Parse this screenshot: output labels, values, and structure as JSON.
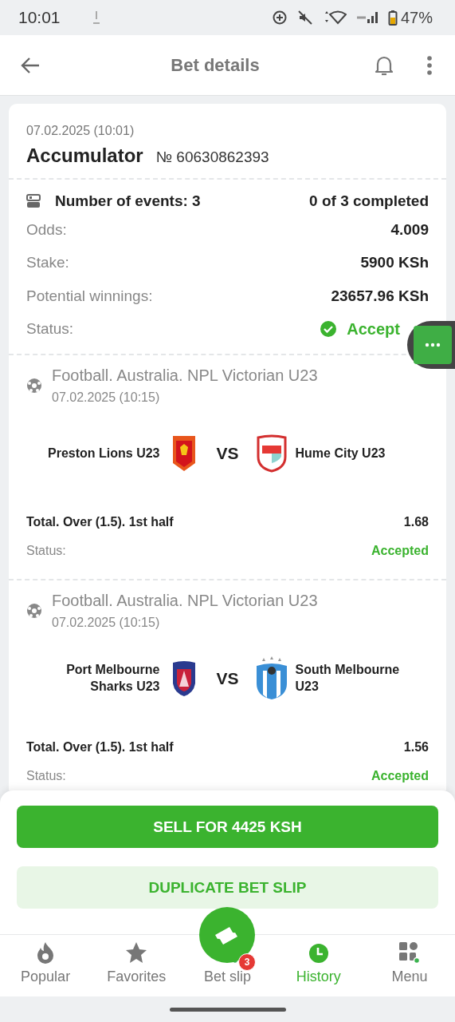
{
  "status_bar": {
    "time": "10:01",
    "battery": "47%"
  },
  "header": {
    "title": "Bet details"
  },
  "bet": {
    "date": "07.02.2025 (10:01)",
    "type": "Accumulator",
    "number": "№ 60630862393"
  },
  "summary": {
    "events": "Number of events: 3",
    "completed": "0 of 3 completed",
    "rows": [
      {
        "label": "Odds:",
        "value": "4.009"
      },
      {
        "label": "Stake:",
        "value": "5900 KSh"
      },
      {
        "label": "Potential winnings:",
        "value": "23657.96 KSh"
      }
    ],
    "status": {
      "label": "Status:",
      "value": "Accept",
      "kind": "accepted"
    }
  },
  "events": [
    {
      "league": "Football. Australia. NPL Victorian U23",
      "date": "07.02.2025 (10:15)",
      "home": "Preston Lions U23",
      "vs": "VS",
      "away": "Hume City U23",
      "market": "Total. Over (1.5). 1st half",
      "odds": "1.68",
      "status_label": "Status:",
      "status": "Accepted",
      "kind": "accepted"
    },
    {
      "league": "Football. Australia. NPL Victorian U23",
      "date": "07.02.2025 (10:15)",
      "home": "Port Melbourne Sharks U23",
      "vs": "VS",
      "away": "South Melbourne U23",
      "market": "Total. Over (1.5). 1st half",
      "odds": "1.56",
      "status_label": "Status:",
      "status": "Accepted",
      "kind": "accepted"
    }
  ],
  "actions": [
    {
      "label": "SELL FOR 4425 KSH",
      "kind": "primary"
    },
    {
      "label": "DUPLICATE BET SLIP",
      "kind": "secondary"
    }
  ],
  "nav": [
    {
      "label": "Popular",
      "selected": false
    },
    {
      "label": "Favorites",
      "selected": false
    },
    {
      "label": "Bet slip",
      "selected": false,
      "badge": "3"
    },
    {
      "label": "History",
      "selected": true
    },
    {
      "label": "Menu",
      "selected": false
    }
  ]
}
